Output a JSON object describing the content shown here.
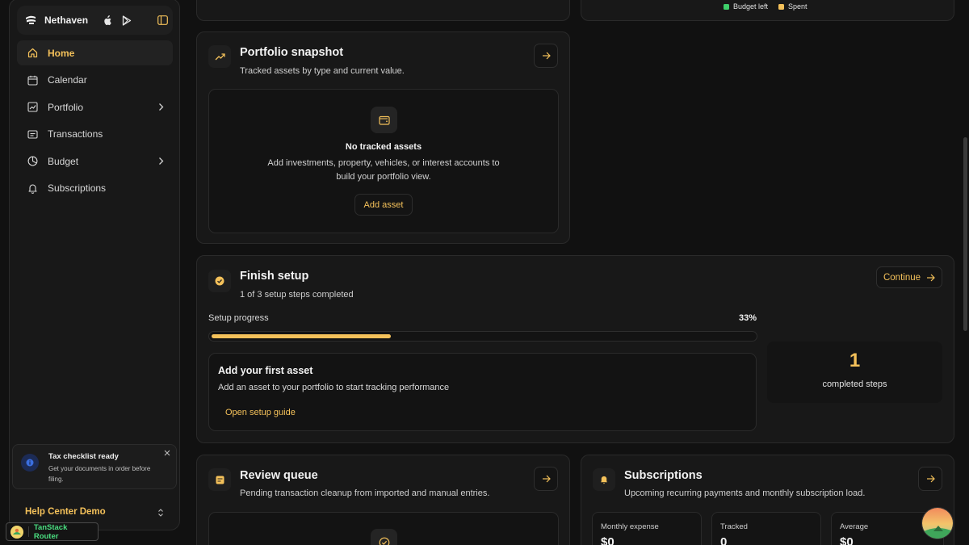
{
  "sidebar": {
    "brand": "Nethaven",
    "nav": [
      {
        "label": "Home",
        "icon": "home-icon",
        "active": true
      },
      {
        "label": "Calendar",
        "icon": "calendar-icon"
      },
      {
        "label": "Portfolio",
        "icon": "trend-icon",
        "expandable": true
      },
      {
        "label": "Transactions",
        "icon": "receipt-icon"
      },
      {
        "label": "Budget",
        "icon": "pie-chart-icon",
        "expandable": true
      },
      {
        "label": "Subscriptions",
        "icon": "bell-icon"
      }
    ],
    "toast": {
      "title": "Tax checklist ready",
      "body": "Get your documents in order before filing."
    },
    "workspace": "Help Center Demo",
    "router_badge": "TanStack Router"
  },
  "budget_card": {
    "legend": [
      {
        "label": "Budget left",
        "color": "#3ecf6a"
      },
      {
        "label": "Spent",
        "color": "#f4c15a"
      }
    ]
  },
  "portfolio": {
    "title": "Portfolio snapshot",
    "subtitle": "Tracked assets by type and current value.",
    "empty_title": "No tracked assets",
    "empty_desc": "Add investments, property, vehicles, or interest accounts to build your portfolio view.",
    "add_label": "Add asset"
  },
  "setup": {
    "title": "Finish setup",
    "subtitle": "1 of 3 setup steps completed",
    "continue_label": "Continue",
    "progress_label": "Setup progress",
    "progress_pct_text": "33%",
    "progress_fraction": 0.33,
    "step_title": "Add your first asset",
    "step_desc": "Add an asset to your portfolio to start tracking performance",
    "step_link": "Open setup guide",
    "completed_count": "1",
    "completed_label": "completed steps"
  },
  "review": {
    "title": "Review queue",
    "subtitle": "Pending transaction cleanup from imported and manual entries."
  },
  "subscriptions": {
    "title": "Subscriptions",
    "subtitle": "Upcoming recurring payments and monthly subscription load.",
    "stats": [
      {
        "label": "Monthly expense",
        "value": "$0"
      },
      {
        "label": "Tracked",
        "value": "0"
      },
      {
        "label": "Average",
        "value": "$0"
      }
    ]
  },
  "colors": {
    "accent": "#f4c15a",
    "background": "#111111",
    "card": "#181818"
  }
}
